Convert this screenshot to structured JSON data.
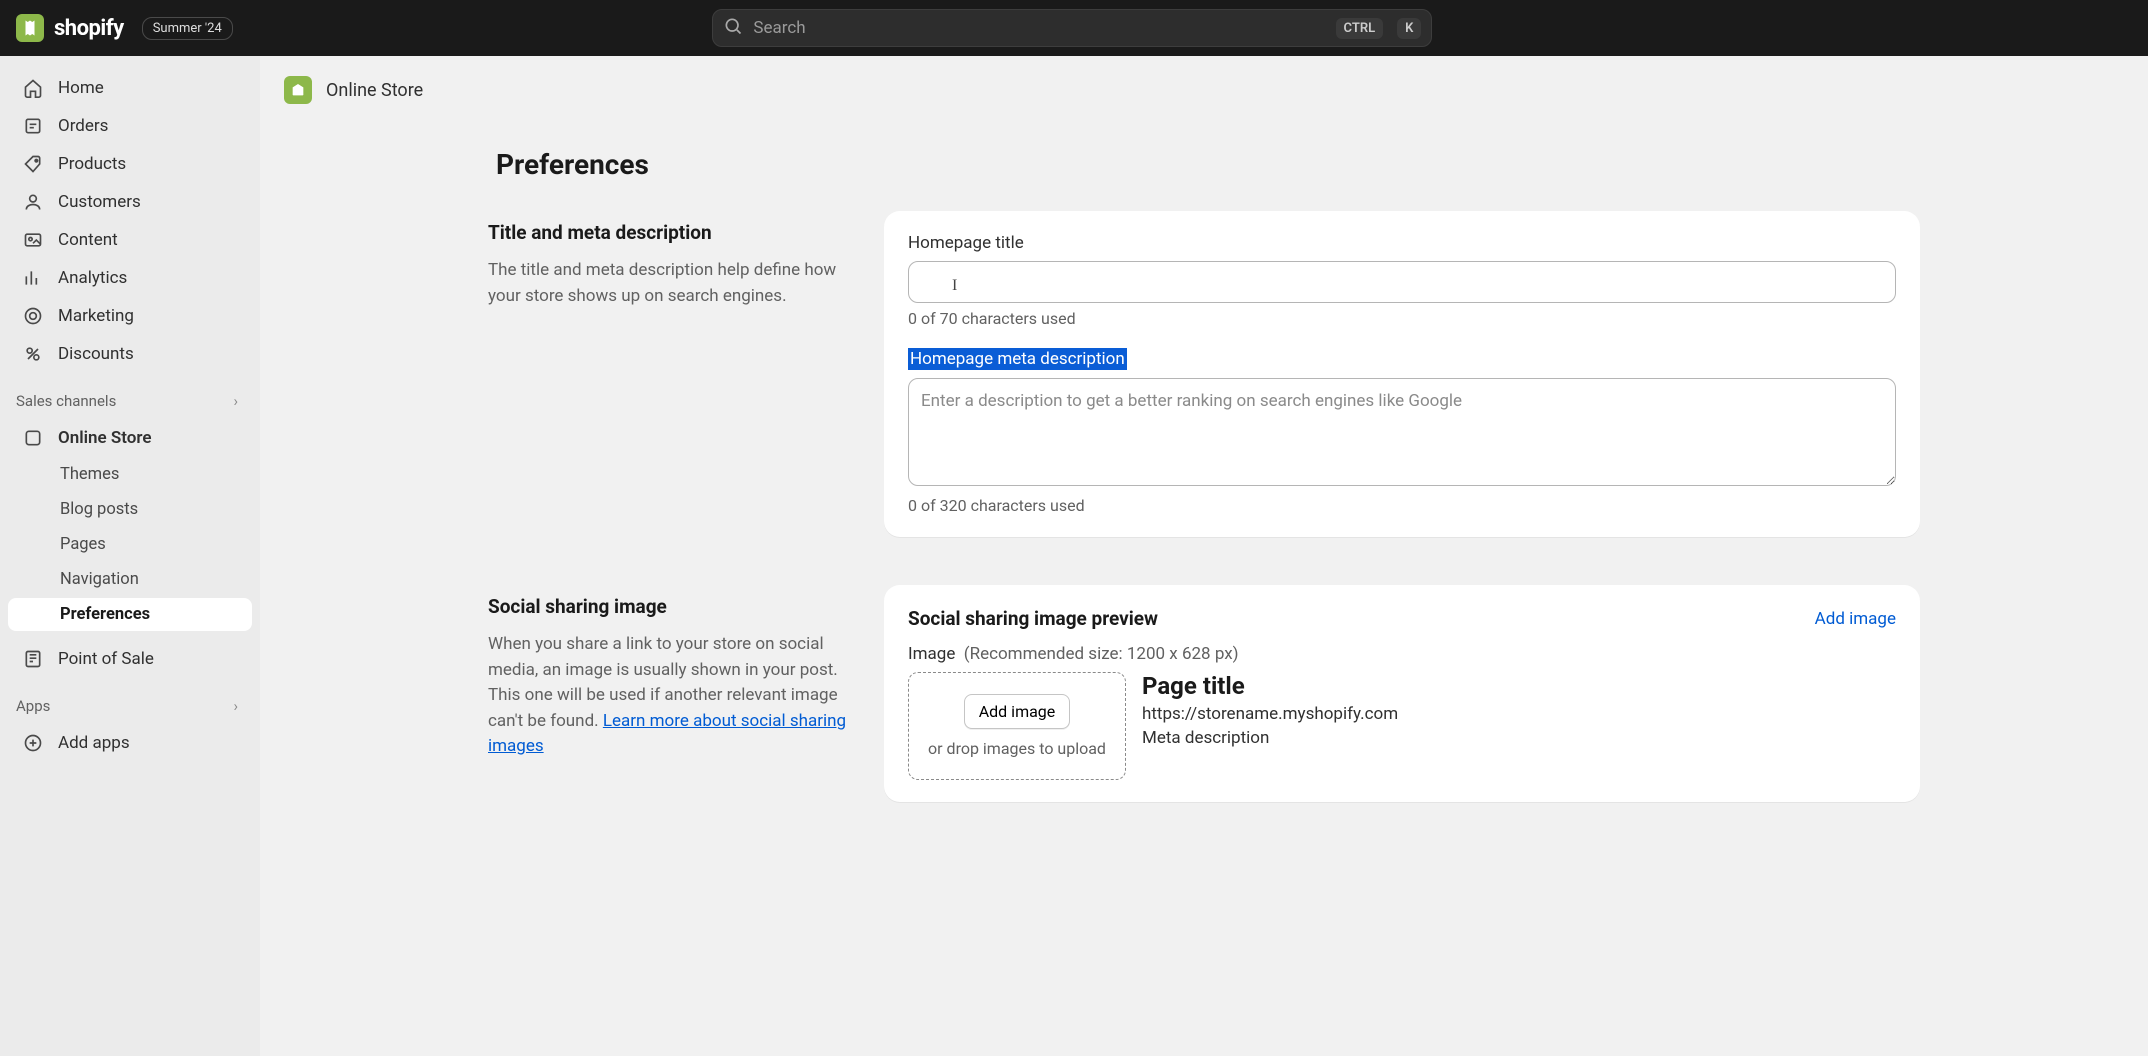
{
  "topbar": {
    "logo_text": "shopify",
    "badge": "Summer '24",
    "search_placeholder": "Search",
    "kbd1": "CTRL",
    "kbd2": "K"
  },
  "sidebar": {
    "primary": [
      {
        "label": "Home"
      },
      {
        "label": "Orders"
      },
      {
        "label": "Products"
      },
      {
        "label": "Customers"
      },
      {
        "label": "Content"
      },
      {
        "label": "Analytics"
      },
      {
        "label": "Marketing"
      },
      {
        "label": "Discounts"
      }
    ],
    "sales_channels_label": "Sales channels",
    "online_store": {
      "label": "Online Store",
      "children": [
        {
          "label": "Themes"
        },
        {
          "label": "Blog posts"
        },
        {
          "label": "Pages"
        },
        {
          "label": "Navigation"
        },
        {
          "label": "Preferences"
        }
      ]
    },
    "pos_label": "Point of Sale",
    "apps_label": "Apps",
    "add_apps_label": "Add apps"
  },
  "breadcrumb": "Online Store",
  "page": {
    "title": "Preferences",
    "title_meta": {
      "heading": "Title and meta description",
      "desc": "The title and meta description help define how your store shows up on search engines.",
      "homepage_title_label": "Homepage title",
      "homepage_title_value": "",
      "homepage_title_helper": "0 of 70 characters used",
      "meta_desc_label": "Homepage meta description",
      "meta_desc_placeholder": "Enter a description to get a better ranking on search engines like Google",
      "meta_desc_helper": "0 of 320 characters used"
    },
    "social": {
      "heading": "Social sharing image",
      "desc_prefix": "When you share a link to your store on social media, an image is usually shown in your post. This one will be used if another relevant image can't be found. ",
      "link_text": "Learn more about social sharing images",
      "card_title": "Social sharing image preview",
      "add_image_link": "Add image",
      "image_legend": "Image",
      "image_hint": "(Recommended size: 1200 x 628 px)",
      "add_image_btn": "Add image",
      "drop_text": "or drop images to upload",
      "preview_title": "Page title",
      "preview_url": "https://storename.myshopify.com",
      "preview_desc": "Meta description"
    }
  }
}
